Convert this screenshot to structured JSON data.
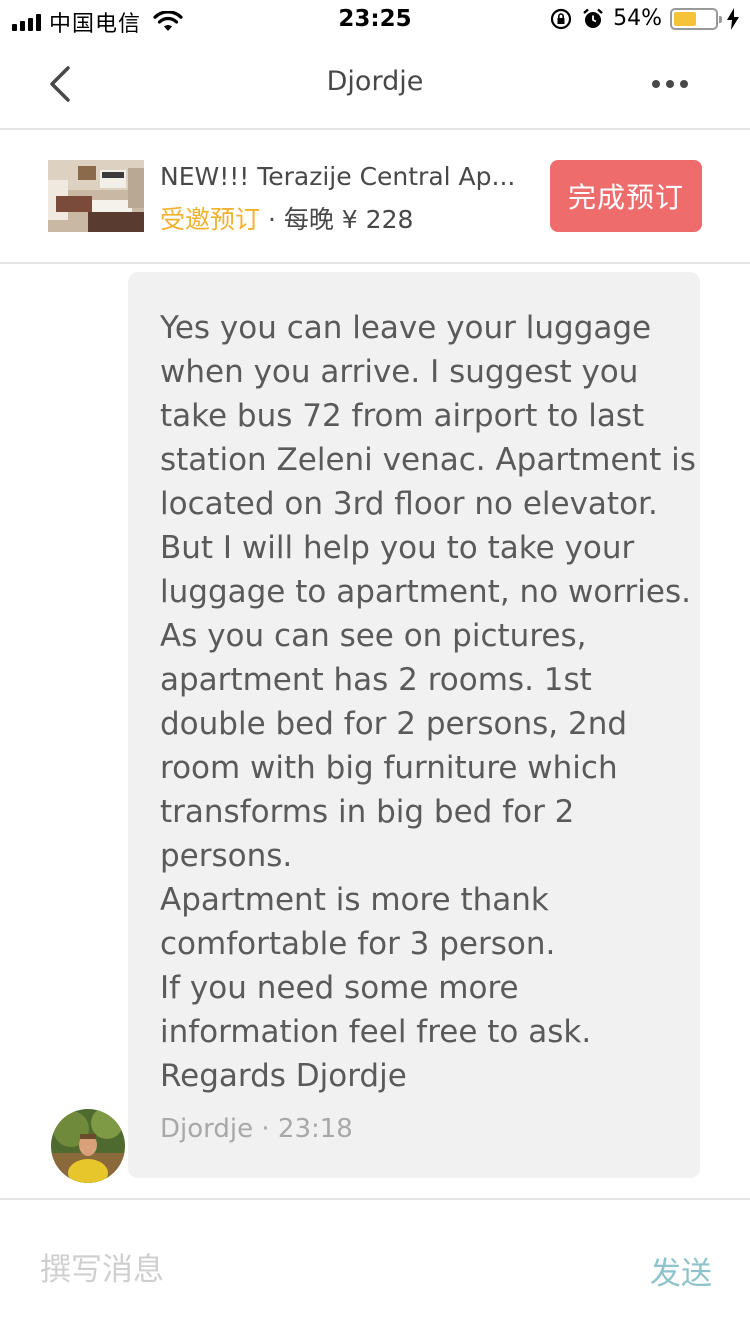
{
  "status_bar": {
    "carrier": "中国电信",
    "time": "23:25",
    "battery_percent_label": "54%",
    "battery_level": 0.54,
    "battery_color": "#f6c23a",
    "icons": [
      "signal-icon",
      "wifi-icon",
      "rotation-lock-icon",
      "alarm-icon",
      "battery-icon",
      "charging-icon"
    ]
  },
  "header": {
    "title": "Djordje",
    "icons": [
      "back-icon",
      "more-icon"
    ]
  },
  "listing": {
    "title": "NEW!!!  Terazije Central Ap...",
    "status": "受邀预订",
    "separator": " · ",
    "price": "每晚 ¥ 228",
    "book_button_label": "完成预订",
    "accent_color": "#ef6c6c",
    "status_color": "#f1b12e"
  },
  "message": {
    "text": "Yes you can leave your luggage when you arrive.  I suggest you take bus 72 from airport to last station Zeleni venac. Apartment is located on 3rd floor no elevator. But I will help you to take your luggage to apartment, no worries. As you can see on pictures, apartment has 2 rooms. 1st double bed for 2 persons, 2nd room with big furniture  which transforms in big bed for 2 persons.\nApartment is more thank comfortable for 3 person.\nIf you need some more information feel free to ask.\nRegards Djordje",
    "sender": "Djordje",
    "time": "23:18",
    "meta": "Djordje · 23:18"
  },
  "composer": {
    "placeholder": "撰写消息",
    "value": "",
    "send_label": "发送",
    "send_color": "#8ec3cb"
  }
}
